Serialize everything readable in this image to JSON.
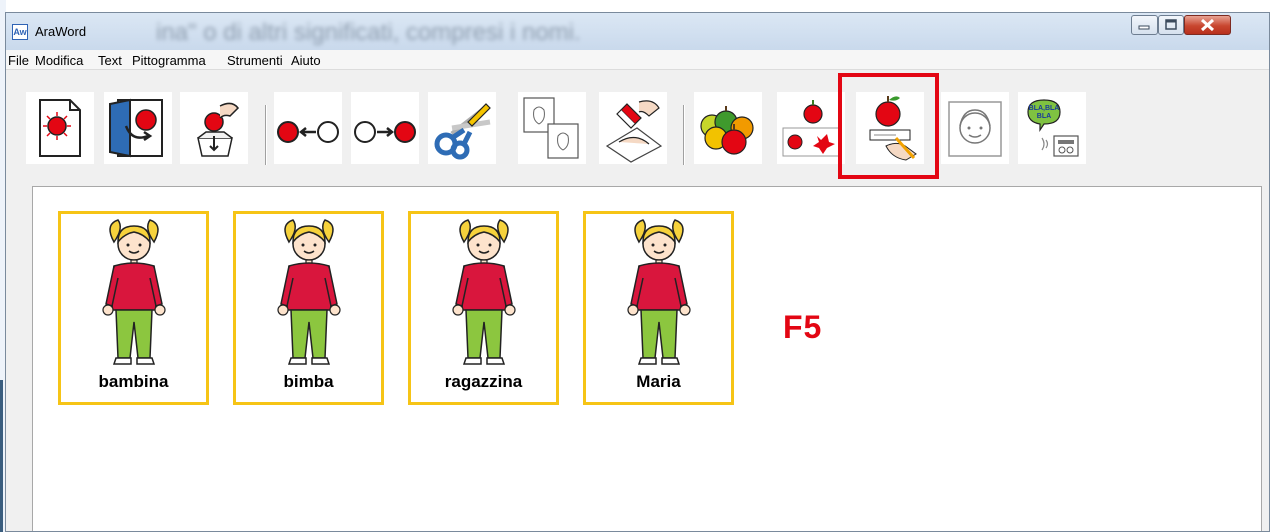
{
  "window": {
    "title": "AraWord",
    "background_title": "ina\" o di altri significati, compresi i nomi."
  },
  "menu": [
    "File",
    "Modifica",
    "Text",
    "Pittogramma",
    "Strumenti",
    "Aiuto"
  ],
  "toolbar": {
    "buttons": [
      {
        "name": "new-document",
        "icon": "page-red-dot-icon"
      },
      {
        "name": "open-document",
        "icon": "door-open-icon"
      },
      {
        "name": "save-document",
        "icon": "save-box-icon"
      },
      {
        "name": "undo",
        "icon": "arrow-left-icon"
      },
      {
        "name": "redo",
        "icon": "arrow-right-icon"
      },
      {
        "name": "cut",
        "icon": "scissors-icon"
      },
      {
        "name": "copy",
        "icon": "copy-icon"
      },
      {
        "name": "paste",
        "icon": "paste-glue-icon"
      },
      {
        "name": "pictogram-change",
        "icon": "apples-icon"
      },
      {
        "name": "pictogram-style",
        "icon": "apple-variants-icon"
      },
      {
        "name": "edit-word",
        "icon": "apple-edit-icon",
        "highlighted": true,
        "shortcut": "F5"
      },
      {
        "name": "pictogram-type",
        "icon": "face-portrait-icon"
      },
      {
        "name": "read-text",
        "icon": "speech-bla-icon",
        "label": "BLA,BLA BLA"
      }
    ]
  },
  "document": {
    "cards": [
      {
        "label": "bambina",
        "pictogram": "girl-icon"
      },
      {
        "label": "bimba",
        "pictogram": "girl-icon"
      },
      {
        "label": "ragazzina",
        "pictogram": "girl-icon"
      },
      {
        "label": "Maria",
        "pictogram": "girl-icon"
      }
    ],
    "annotation": "F5"
  },
  "colors": {
    "highlight": "#e30613",
    "card_border": "#f6c416",
    "annotation": "#e30613"
  }
}
